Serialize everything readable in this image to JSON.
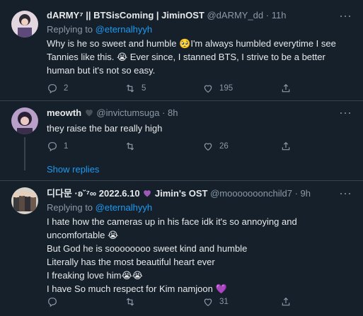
{
  "tweets": [
    {
      "name": "dARMY⁷ || BTSisComing | JiminOST",
      "handle": "@dARMY_dd",
      "sep": "·",
      "time": "11h",
      "replying_prefix": "Replying to ",
      "replying_to": "@eternalhyyh",
      "lines": [
        "Why is he so sweet and humble 🥺I'm always humbled everytime I see",
        "Tannies like this. 😭 Ever since, I stanned BTS, I strive to be a better",
        "human but it's not so easy."
      ],
      "replies": "2",
      "retweets": "5",
      "likes": "195"
    },
    {
      "name": "meowth",
      "handle": "@invictumsuga",
      "sep": "·",
      "time": "8h",
      "lines": [
        "they raise the bar really high"
      ],
      "replies": "1",
      "retweets": "",
      "likes": "26"
    },
    {
      "name": "디다문 ·ʚ˘⁷∞ 2022.6.10",
      "name_suffix": " Jimin's OST",
      "handle": "@mooooooonchild7",
      "sep": "·",
      "time": "9h",
      "replying_prefix": "Replying to ",
      "replying_to": "@eternalhyyh",
      "lines": [
        "I hate how the cameras up in his face idk it's so annoying and",
        "uncomfortable 😭",
        "But God he is soooooooo sweet kind and humble",
        "Literally has the most beautiful heart ever",
        "I freaking love him😭😭",
        "I have So much respect for Kim namjoon 💜"
      ],
      "replies": "",
      "retweets": "",
      "likes": "31"
    }
  ],
  "show_replies": "Show replies",
  "icons": {
    "reply": "reply-icon",
    "retweet": "retweet-icon",
    "like": "heart-icon",
    "share": "share-icon",
    "more": "more-icon"
  },
  "colors": {
    "background": "#15202b",
    "link": "#1d9bf0",
    "muted": "#8b98a5",
    "heart_emoji": "#9b59b6",
    "black_heart": "#2f3336"
  }
}
